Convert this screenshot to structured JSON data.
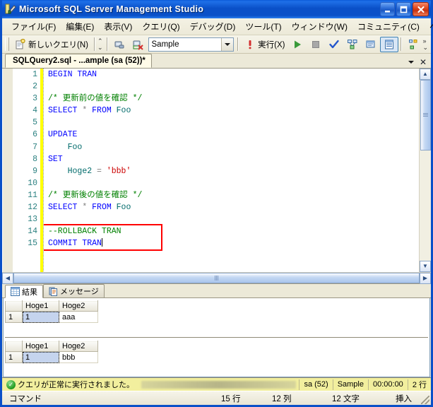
{
  "window": {
    "title": "Microsoft SQL Server Management Studio",
    "app_icon": "ssms-icon",
    "controls": {
      "minimize": "_",
      "maximize": "□",
      "close": "✕"
    }
  },
  "menubar": {
    "items": [
      {
        "label": "ファイル(F)",
        "name": "menu-file"
      },
      {
        "label": "編集(E)",
        "name": "menu-edit"
      },
      {
        "label": "表示(V)",
        "name": "menu-view"
      },
      {
        "label": "クエリ(Q)",
        "name": "menu-query"
      },
      {
        "label": "デバッグ(D)",
        "name": "menu-debug"
      },
      {
        "label": "ツール(T)",
        "name": "menu-tools"
      },
      {
        "label": "ウィンドウ(W)",
        "name": "menu-window"
      },
      {
        "label": "コミュニティ(C)",
        "name": "menu-community"
      },
      {
        "label": "ヘルプ(H)",
        "name": "menu-help"
      }
    ]
  },
  "toolbar": {
    "new_query_label": "新しいクエリ(N)",
    "database_value": "Sample",
    "execute_label": "実行(X)",
    "icons": {
      "new_query": "new-query-icon",
      "connect": "connect-object-explorer-icon",
      "disconnect": "disconnect-icon",
      "execute_bang": "execute-bang-icon",
      "debug_play": "debug-play-icon",
      "stop": "stop-icon",
      "parse_check": "parse-check-icon",
      "display_plan": "display-estimated-plan-icon",
      "query_options": "query-options-icon",
      "results_to_grid": "results-to-grid-icon",
      "include_plan": "include-actual-plan-icon"
    }
  },
  "document_tab": {
    "label": "SQLQuery2.sql - ...ample (sa (52))*",
    "dropdown_icon": "chevron-down-icon",
    "close_icon": "close-icon"
  },
  "editor": {
    "line_numbers": [
      "1",
      "2",
      "3",
      "4",
      "5",
      "6",
      "7",
      "8",
      "9",
      "10",
      "11",
      "12",
      "13",
      "14",
      "15"
    ],
    "lines": [
      {
        "n": 1,
        "tokens": [
          {
            "t": "BEGIN TRAN",
            "c": "kw"
          }
        ]
      },
      {
        "n": 2,
        "tokens": []
      },
      {
        "n": 3,
        "tokens": [
          {
            "t": "/* 更新前の値を確認 */",
            "c": "cm"
          }
        ]
      },
      {
        "n": 4,
        "tokens": [
          {
            "t": "SELECT",
            "c": "kw"
          },
          {
            "t": " ",
            "c": "op"
          },
          {
            "t": "*",
            "c": "op"
          },
          {
            "t": " ",
            "c": "op"
          },
          {
            "t": "FROM",
            "c": "kw"
          },
          {
            "t": " ",
            "c": "op"
          },
          {
            "t": "Foo",
            "c": "ident"
          }
        ]
      },
      {
        "n": 5,
        "tokens": []
      },
      {
        "n": 6,
        "tokens": [
          {
            "t": "UPDATE",
            "c": "kw"
          }
        ]
      },
      {
        "n": 7,
        "tokens": [
          {
            "t": "    ",
            "c": "op"
          },
          {
            "t": "Foo",
            "c": "ident"
          }
        ]
      },
      {
        "n": 8,
        "tokens": [
          {
            "t": "SET",
            "c": "kw"
          }
        ]
      },
      {
        "n": 9,
        "tokens": [
          {
            "t": "    ",
            "c": "op"
          },
          {
            "t": "Hoge2",
            "c": "ident"
          },
          {
            "t": " ",
            "c": "op"
          },
          {
            "t": "=",
            "c": "op"
          },
          {
            "t": " ",
            "c": "op"
          },
          {
            "t": "'bbb'",
            "c": "str"
          }
        ]
      },
      {
        "n": 10,
        "tokens": []
      },
      {
        "n": 11,
        "tokens": [
          {
            "t": "/* 更新後の値を確認 */",
            "c": "cm"
          }
        ]
      },
      {
        "n": 12,
        "tokens": [
          {
            "t": "SELECT",
            "c": "kw"
          },
          {
            "t": " ",
            "c": "op"
          },
          {
            "t": "*",
            "c": "op"
          },
          {
            "t": " ",
            "c": "op"
          },
          {
            "t": "FROM",
            "c": "kw"
          },
          {
            "t": " ",
            "c": "op"
          },
          {
            "t": "Foo",
            "c": "ident"
          }
        ]
      },
      {
        "n": 13,
        "tokens": []
      },
      {
        "n": 14,
        "tokens": [
          {
            "t": "--ROLLBACK TRAN",
            "c": "cm"
          }
        ]
      },
      {
        "n": 15,
        "tokens": [
          {
            "t": "COMMIT TRAN",
            "c": "kw"
          },
          {
            "t": "|CARET|",
            "c": "caret"
          }
        ]
      }
    ],
    "annotation_color": "#ff0000",
    "change_bar_color": "#ffff00"
  },
  "results_panel": {
    "tabs": [
      {
        "label": "結果",
        "name": "tab-results",
        "icon": "grid-icon",
        "active": true
      },
      {
        "label": "メッセージ",
        "name": "tab-messages",
        "icon": "messages-icon",
        "active": false
      }
    ],
    "grids": [
      {
        "row_header": "",
        "columns": [
          "Hoge1",
          "Hoge2"
        ],
        "rows": [
          {
            "num": "1",
            "cells": [
              "1",
              "aaa"
            ],
            "selected_index": 0
          }
        ]
      },
      {
        "row_header": "",
        "columns": [
          "Hoge1",
          "Hoge2"
        ],
        "rows": [
          {
            "num": "1",
            "cells": [
              "1",
              "bbb"
            ],
            "selected_index": 0
          }
        ]
      }
    ]
  },
  "query_status": {
    "icon": "success-icon",
    "message": "クエリが正常に実行されました。",
    "server": "",
    "user": "sa (52)",
    "database": "Sample",
    "elapsed": "00:00:00",
    "rows": "2 行"
  },
  "status_bar": {
    "mode": "コマンド",
    "line": "15 行",
    "column": "12 列",
    "character": "12 文字",
    "insert": "挿入"
  },
  "colors": {
    "title_blue": "#0a50c8",
    "keyword": "#0000ff",
    "comment": "#008000",
    "identifier": "#006b6b",
    "string": "#cc0000",
    "status_yellow": "#f2ef9e"
  }
}
